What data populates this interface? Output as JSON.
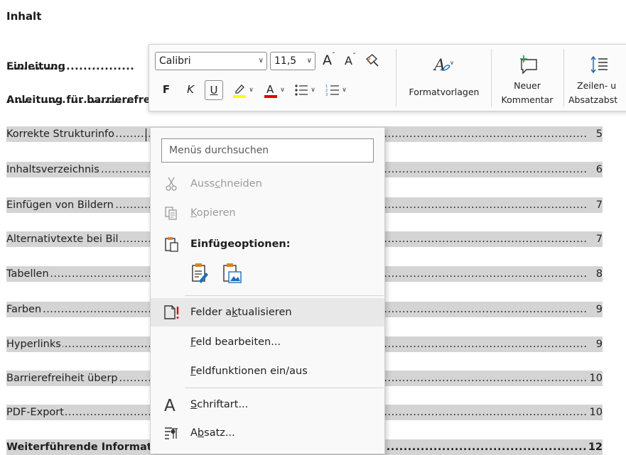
{
  "document": {
    "heading": "Inhalt",
    "toc": [
      {
        "title": "Einleitung",
        "page": "",
        "bold": true,
        "field": false
      },
      {
        "title": "Anleitung für barrierefreie",
        "page": "",
        "bold": true,
        "field": false
      },
      {
        "title": "Korrekte Strukturinfo",
        "page": "5",
        "bold": false,
        "field": true
      },
      {
        "title": "Inhaltsverzeichnis",
        "page": "6",
        "bold": false,
        "field": true
      },
      {
        "title": "Einfügen von Bildern",
        "page": "7",
        "bold": false,
        "field": true
      },
      {
        "title": "Alternativtexte bei Bil",
        "page": "7",
        "bold": false,
        "field": true
      },
      {
        "title": "Tabellen",
        "page": "8",
        "bold": false,
        "field": true
      },
      {
        "title": "Farben",
        "page": "9",
        "bold": false,
        "field": true
      },
      {
        "title": "Hyperlinks",
        "page": "9",
        "bold": false,
        "field": true
      },
      {
        "title": "Barrierefreiheit überp",
        "page": "10",
        "bold": false,
        "field": true
      },
      {
        "title": "PDF-Export",
        "page": "10",
        "bold": false,
        "field": true
      },
      {
        "title": "Weiterführende Informationen",
        "page": "12",
        "bold": true,
        "field": true
      }
    ]
  },
  "mini_toolbar": {
    "font_name": "Calibri",
    "font_size": "11,5",
    "grow_font": "A",
    "shrink_font": "A",
    "bold": "F",
    "italic": "K",
    "underline": "U",
    "highlight_color": "#ffff00",
    "font_color": "#e00000",
    "styles_label": "Formatvorlagen",
    "new_comment_line1": "Neuer",
    "new_comment_line2": "Kommentar",
    "line_spacing_line1": "Zeilen- u",
    "line_spacing_line2": "Absatzabst"
  },
  "context_menu": {
    "search_placeholder": "Menüs durchsuchen",
    "cut": {
      "pre": "Auss",
      "acc": "c",
      "post": "hneiden"
    },
    "copy": {
      "pre": "",
      "acc": "K",
      "post": "opieren"
    },
    "paste_options": "Einfügeoptionen:",
    "update_field": {
      "pre": "Felder a",
      "acc": "k",
      "post": "tualisieren"
    },
    "edit_field": {
      "pre": "",
      "acc": "F",
      "post": "eld bearbeiten..."
    },
    "toggle_codes": {
      "pre": "",
      "acc": "F",
      "post": "eldfunktionen ein/aus"
    },
    "font": {
      "pre": "",
      "acc": "S",
      "post": "chriftart..."
    },
    "paragraph": {
      "pre": "A",
      "acc": "b",
      "post": "satz..."
    }
  },
  "colors": {
    "field_shading": "#d4d4d4",
    "menu_bg": "#f9f9f9",
    "hover": "#e8e8e8",
    "accent_orange": "#d9822b",
    "accent_blue": "#1f6fb5",
    "comment_green": "#2e9d4a"
  },
  "icons": {
    "cut": "scissors-icon",
    "copy": "copy-icon",
    "paste": "clipboard-icon",
    "update_field": "update-field-icon",
    "font": "font-icon",
    "paragraph": "paragraph-icon"
  }
}
